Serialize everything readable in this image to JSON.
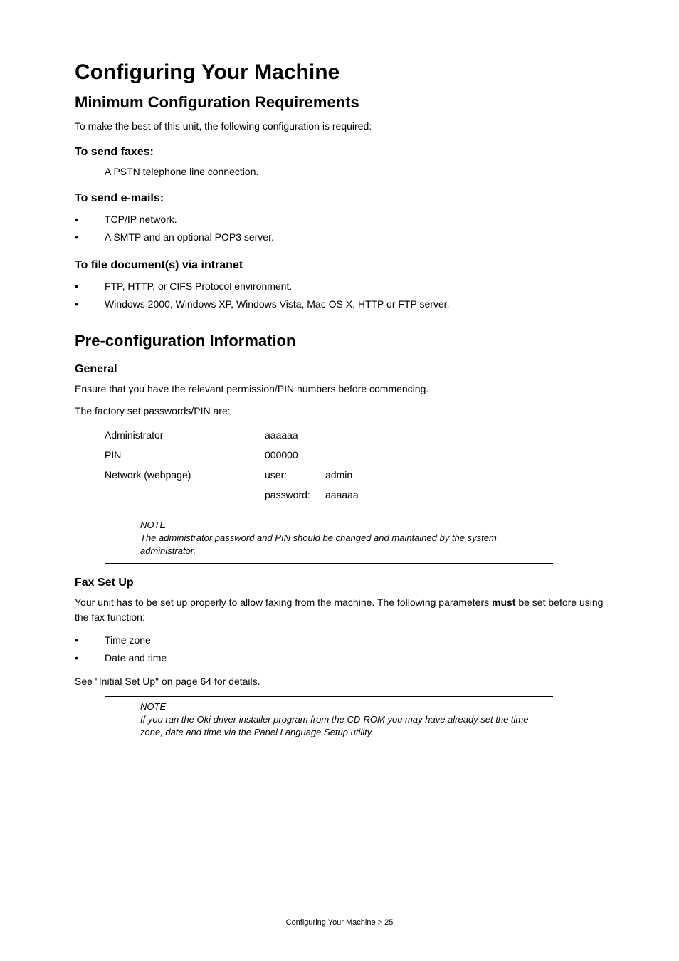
{
  "page_title": "Configuring Your Machine",
  "section1": {
    "heading": "Minimum Configuration Requirements",
    "intro": "To make the best of this unit, the following configuration is required:",
    "sub_fax": {
      "heading": "To send faxes:",
      "line": "A PSTN telephone line connection."
    },
    "sub_email": {
      "heading": "To send e-mails:",
      "items": [
        "TCP/IP network.",
        "A SMTP and an optional POP3 server."
      ]
    },
    "sub_file": {
      "heading": "To file document(s) via intranet",
      "items": [
        "FTP, HTTP, or CIFS Protocol environment.",
        "Windows 2000, Windows XP, Windows Vista, Mac OS X, HTTP or FTP server."
      ]
    }
  },
  "section2": {
    "heading": "Pre-configuration Information",
    "general": {
      "heading": "General",
      "p1": "Ensure that you have the relevant permission/PIN numbers before commencing.",
      "p2": "The factory set passwords/PIN are:",
      "creds": {
        "admin_label": "Administrator",
        "admin_value": "aaaaaa",
        "pin_label": "PIN",
        "pin_value": "000000",
        "net_label": "Network (webpage)",
        "net_user_key": "user:",
        "net_user_val": "admin",
        "net_pass_key": "password:",
        "net_pass_val": "aaaaaa"
      },
      "note_title": "NOTE",
      "note_body": "The administrator password and PIN should be changed and maintained by the system administrator."
    },
    "fax": {
      "heading": "Fax Set Up",
      "p1_pre": "Your unit has to be set up properly to allow faxing from the machine. The following parameters ",
      "p1_bold": "must",
      "p1_post": " be set before using the fax function:",
      "items": [
        "Time zone",
        "Date and time"
      ],
      "see": "See \"Initial Set Up\" on page 64 for details.",
      "note_title": "NOTE",
      "note_body": "If you ran the Oki driver installer program from the CD-ROM you may have already set the time zone, date and time via the Panel Language Setup utility."
    }
  },
  "footer": "Configuring Your Machine > 25"
}
